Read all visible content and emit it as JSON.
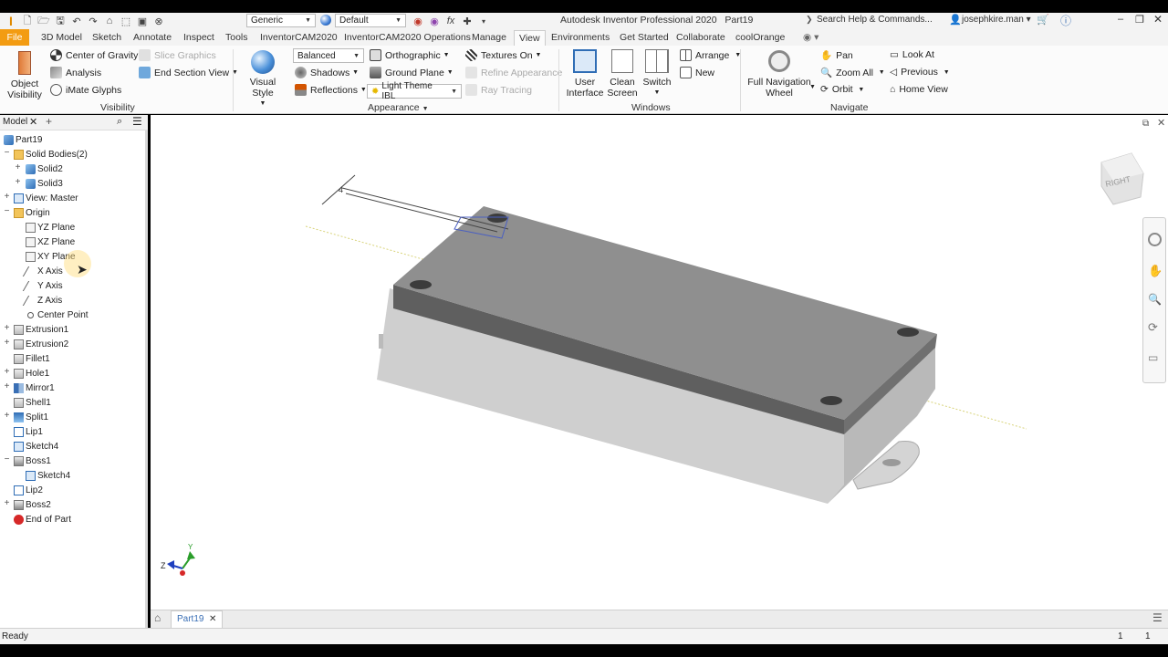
{
  "app": {
    "title": "Autodesk Inventor Professional 2020",
    "document": "Part19",
    "search_placeholder": "Search Help & Commands...",
    "user": "josephkire.man"
  },
  "qat": {
    "material_combo": "Generic",
    "appearance_combo": "Default"
  },
  "menu_tabs": [
    "File",
    "3D Model",
    "Sketch",
    "Annotate",
    "Inspect",
    "Tools",
    "InventorCAM2020",
    "InventorCAM2020 Operations",
    "Manage",
    "View",
    "Environments",
    "Get Started",
    "Collaborate",
    "coolOrange"
  ],
  "ribbon": {
    "visibility": {
      "object_visibility": [
        "Object",
        "Visibility"
      ],
      "center_of_gravity": "Center of Gravity",
      "slice_graphics": "Slice Graphics",
      "analysis": "Analysis",
      "end_section_view": "End Section View",
      "imate_glyphs": "iMate Glyphs",
      "title": "Visibility"
    },
    "appearance": {
      "visual_style": "Visual Style",
      "balanced": "Balanced",
      "orthographic": "Orthographic",
      "textures_on": "Textures On",
      "shadows": "Shadows",
      "ground_plane": "Ground Plane",
      "refine_appearance": "Refine Appearance",
      "reflections": "Reflections",
      "light_theme": "Light Theme IBL",
      "ray_tracing": "Ray Tracing",
      "title": "Appearance"
    },
    "windows": {
      "user_interface": [
        "User",
        "Interface"
      ],
      "clean_screen": [
        "Clean",
        "Screen"
      ],
      "switch": "Switch",
      "arrange": "Arrange",
      "new": "New",
      "title": "Windows"
    },
    "navigate": {
      "full_nav_wheel": [
        "Full Navigation",
        "Wheel"
      ],
      "pan": "Pan",
      "zoom_all": "Zoom All",
      "orbit": "Orbit",
      "look_at": "Look At",
      "previous": "Previous",
      "home_view": "Home View",
      "title": "Navigate"
    }
  },
  "browser": {
    "tab_label": "Model",
    "tree": [
      {
        "label": "Part19",
        "indent": 0,
        "expander": "",
        "icon": "part"
      },
      {
        "label": "Solid Bodies(2)",
        "indent": 1,
        "expander": "−",
        "icon": "folder"
      },
      {
        "label": "Solid2",
        "indent": 2,
        "expander": "+",
        "icon": "solid"
      },
      {
        "label": "Solid3",
        "indent": 2,
        "expander": "+",
        "icon": "solid"
      },
      {
        "label": "View: Master",
        "indent": 1,
        "expander": "+",
        "icon": "view"
      },
      {
        "label": "Origin",
        "indent": 1,
        "expander": "−",
        "icon": "folder"
      },
      {
        "label": "YZ Plane",
        "indent": 2,
        "expander": "",
        "icon": "plane"
      },
      {
        "label": "XZ Plane",
        "indent": 2,
        "expander": "",
        "icon": "plane"
      },
      {
        "label": "XY Plane",
        "indent": 2,
        "expander": "",
        "icon": "plane"
      },
      {
        "label": "X Axis",
        "indent": 2,
        "expander": "",
        "icon": "axis"
      },
      {
        "label": "Y Axis",
        "indent": 2,
        "expander": "",
        "icon": "axis"
      },
      {
        "label": "Z Axis",
        "indent": 2,
        "expander": "",
        "icon": "axis"
      },
      {
        "label": "Center Point",
        "indent": 2,
        "expander": "",
        "icon": "point"
      },
      {
        "label": "Extrusion1",
        "indent": 1,
        "expander": "+",
        "icon": "feature"
      },
      {
        "label": "Extrusion2",
        "indent": 1,
        "expander": "+",
        "icon": "feature"
      },
      {
        "label": "Fillet1",
        "indent": 1,
        "expander": "",
        "icon": "feature"
      },
      {
        "label": "Hole1",
        "indent": 1,
        "expander": "+",
        "icon": "feature"
      },
      {
        "label": "Mirror1",
        "indent": 1,
        "expander": "+",
        "icon": "mirror"
      },
      {
        "label": "Shell1",
        "indent": 1,
        "expander": "",
        "icon": "feature"
      },
      {
        "label": "Split1",
        "indent": 1,
        "expander": "+",
        "icon": "split"
      },
      {
        "label": "Lip1",
        "indent": 1,
        "expander": "",
        "icon": "lip"
      },
      {
        "label": "Sketch4",
        "indent": 1,
        "expander": "",
        "icon": "sketch"
      },
      {
        "label": "Boss1",
        "indent": 1,
        "expander": "−",
        "icon": "boss"
      },
      {
        "label": "Sketch4",
        "indent": 2,
        "expander": "",
        "icon": "sketch"
      },
      {
        "label": "Lip2",
        "indent": 1,
        "expander": "",
        "icon": "lip"
      },
      {
        "label": "Boss2",
        "indent": 1,
        "expander": "+",
        "icon": "boss"
      },
      {
        "label": "End of Part",
        "indent": 1,
        "expander": "",
        "icon": "end"
      }
    ]
  },
  "viewport": {
    "viewcube_label": "RIGHT",
    "dimension_text": "4",
    "triad": {
      "x": "Z",
      "y": "Y"
    }
  },
  "doc_tab": "Part19",
  "status": {
    "text": "Ready",
    "count1": "1",
    "count2": "1"
  },
  "colors": {
    "file_tab": "#f39c12",
    "part_top": "#8f8f8f",
    "part_side": "#c8c8c8",
    "split_band": "#5f5f5f"
  }
}
